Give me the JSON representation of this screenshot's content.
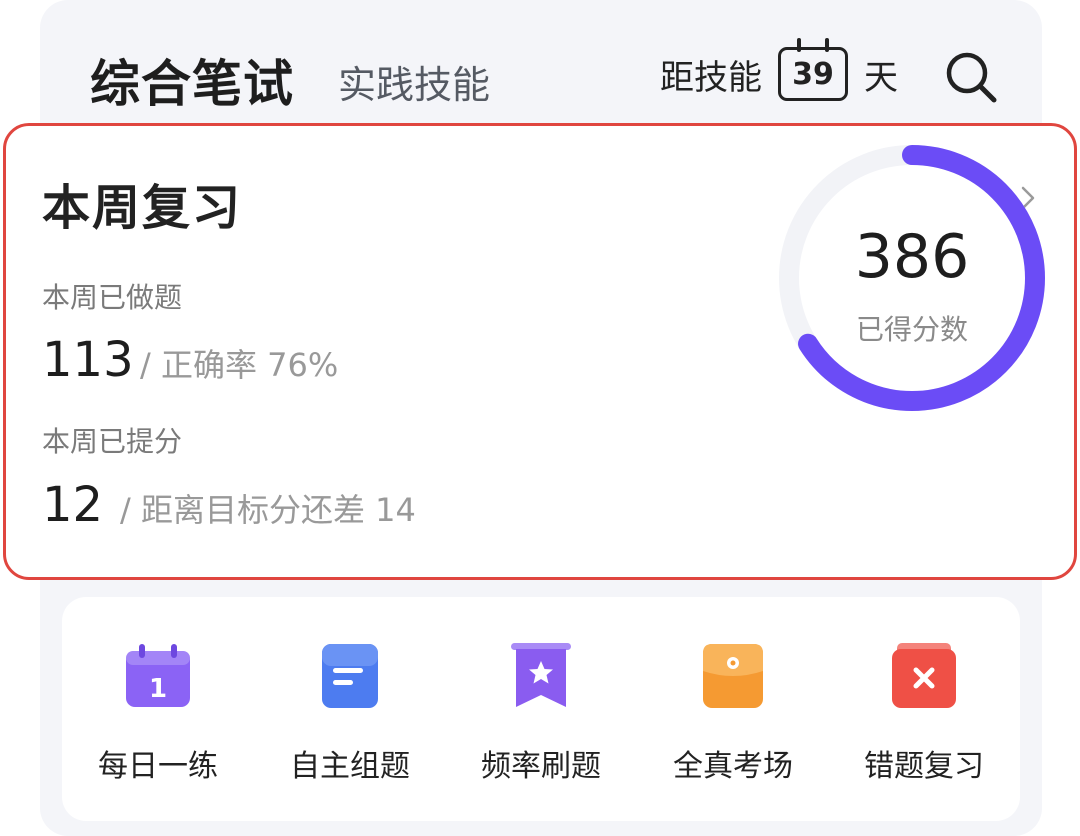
{
  "header": {
    "tab_primary": "综合笔试",
    "tab_secondary": "实践技能",
    "countdown_prefix": "距技能",
    "countdown_days": "39",
    "countdown_suffix": "天"
  },
  "weekly": {
    "title": "本周复习",
    "done_label": "本周已做题",
    "done_count": "113",
    "accuracy_text": "/ 正确率 76%",
    "raised_label": "本周已提分",
    "raised_count": "12",
    "gap_text": "/ 距离目标分还差 14",
    "score_value": "386",
    "score_label": "已得分数",
    "score_progress_percent": 66
  },
  "functions": [
    {
      "label": "每日一练",
      "icon": "daily-calendar-icon",
      "color": "#8b63f5"
    },
    {
      "label": "自主组题",
      "icon": "document-icon",
      "color": "#4d7cf0"
    },
    {
      "label": "频率刷题",
      "icon": "star-bookmark-icon",
      "color": "#8a5cf0"
    },
    {
      "label": "全真考场",
      "icon": "exam-folder-icon",
      "color": "#f59a32"
    },
    {
      "label": "错题复习",
      "icon": "wrong-x-icon",
      "color": "#ef5046"
    }
  ],
  "colors": {
    "accent": "#6b4cf6",
    "highlight_border": "#e0463f"
  }
}
